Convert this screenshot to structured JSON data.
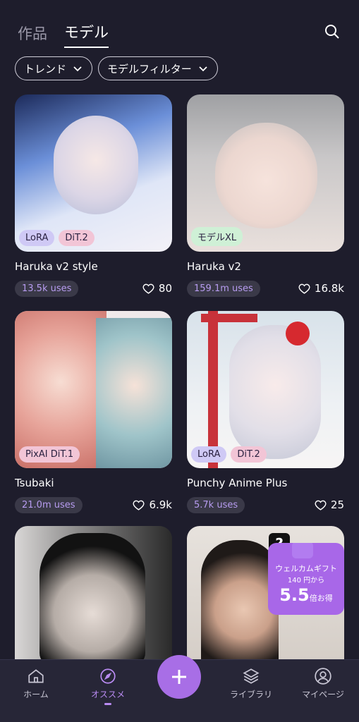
{
  "header": {
    "tabs": [
      {
        "label": "作品",
        "active": false
      },
      {
        "label": "モデル",
        "active": true
      }
    ],
    "search_icon": "search-icon"
  },
  "filters": {
    "trend_label": "トレンド",
    "model_filter_label": "モデルフィルター"
  },
  "cards": [
    {
      "title": "Haruka v2 style",
      "badges": [
        "LoRA",
        "DiT.2"
      ],
      "uses": "13.5k uses",
      "likes": "80"
    },
    {
      "title": "Haruka v2",
      "badges": [
        "モデルXL"
      ],
      "uses": "159.1m uses",
      "likes": "16.8k"
    },
    {
      "title": "Tsubaki",
      "badges": [
        "PixAI DiT.1"
      ],
      "uses": "21.0m uses",
      "likes": "6.9k"
    },
    {
      "title": "Punchy Anime Plus",
      "badges": [
        "LoRA",
        "DiT.2"
      ],
      "uses": "5.7k uses",
      "likes": "25"
    }
  ],
  "promo": {
    "line1": "ウェルカムギフト",
    "line2": "140 円から",
    "big": "5.5",
    "suffix": "倍お得"
  },
  "nav": {
    "home": "ホーム",
    "recommend": "オススメ",
    "library": "ライブラリ",
    "mypage": "マイページ"
  },
  "colors": {
    "background": "#1e1d2c",
    "accent": "#a86ee6",
    "uses_text": "#b79cf0"
  }
}
